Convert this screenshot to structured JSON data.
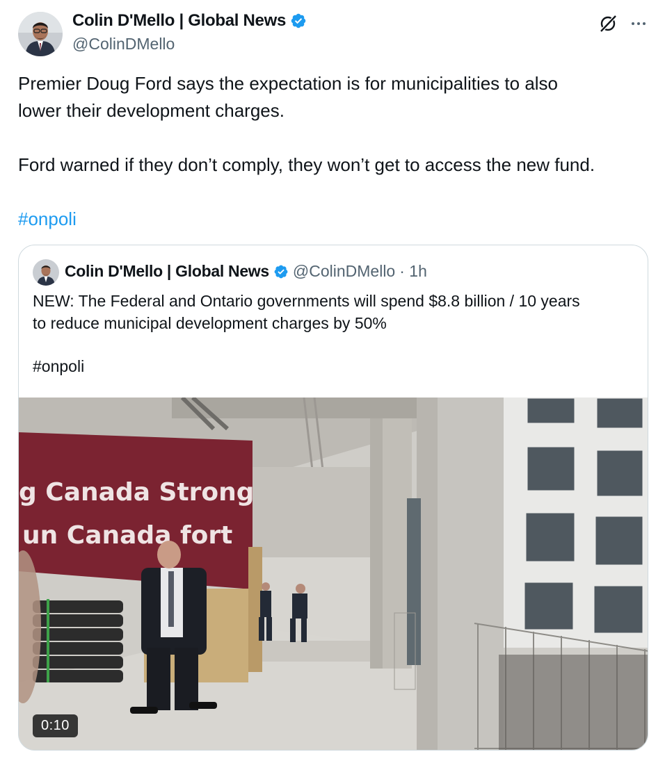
{
  "tweet": {
    "author": {
      "display_name": "Colin D'Mello | Global News",
      "handle": "@ColinDMello",
      "verified": true
    },
    "body": [
      "Premier Doug Ford says the expectation is for municipalities to also",
      "lower their development charges.",
      "Ford warned if they don’t comply, they won’t get to access the new fund."
    ],
    "hashtag": "#onpoli",
    "icons": {
      "grok": "grok-icon",
      "more": "more-icon",
      "verified": "verified-badge-icon"
    }
  },
  "quote": {
    "author": {
      "display_name": "Colin D'Mello | Global News",
      "handle": "@ColinDMello",
      "time": "· 1h"
    },
    "body": [
      "NEW: The Federal and Ontario governments will spend $8.8 billion / 10 years",
      "to reduce municipal development charges by 50%"
    ],
    "hashtag": "#onpoli",
    "video": {
      "duration": "0:10",
      "banner_lines": [
        "g Canada Strong",
        "un Canada fort"
      ]
    }
  },
  "colors": {
    "accent": "#1d9bf0",
    "text": "#0f1419",
    "secondary": "#536471",
    "border": "#cfd9de",
    "banner": "#7b2331"
  }
}
